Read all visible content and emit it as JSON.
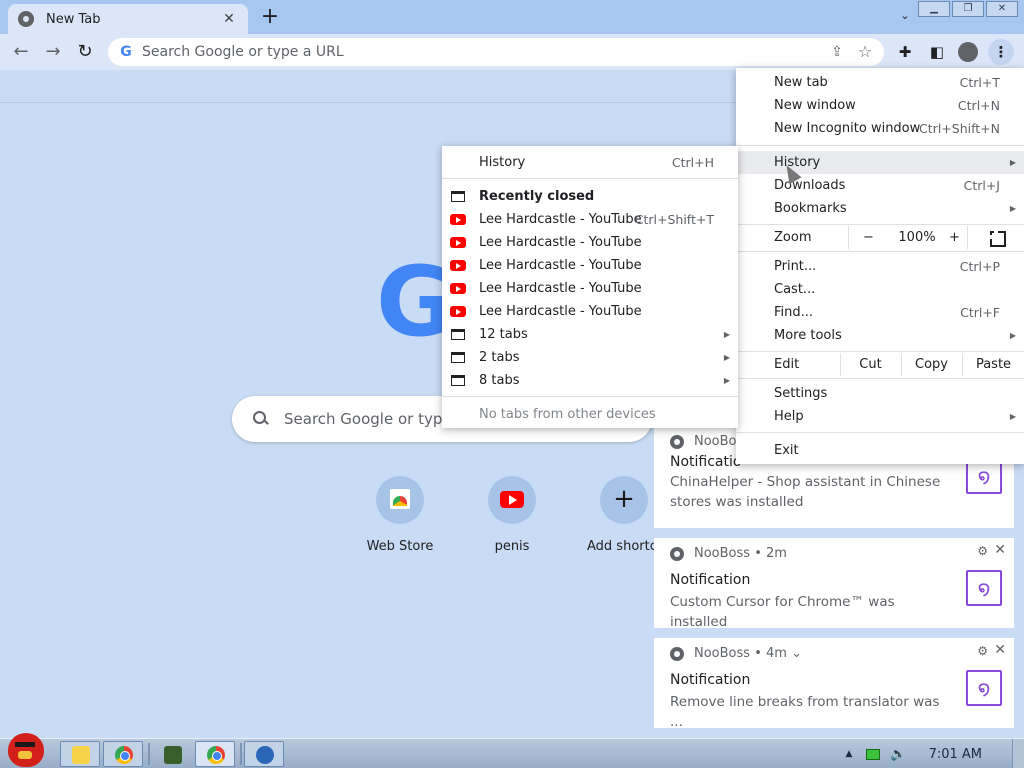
{
  "tab": {
    "title": "New Tab",
    "close": "✕"
  },
  "tabstrip": {
    "new_tab": "+",
    "tab_search": "⌄"
  },
  "window_controls": {
    "minimize": "▁",
    "restore": "❐",
    "close": "✕"
  },
  "toolbar": {
    "back": "←",
    "forward": "→",
    "reload": "↻",
    "omnibox_placeholder": "Search Google or type a URL",
    "share": "⇪",
    "bookmark": "☆",
    "extensions": "✚",
    "sidepanel": "◧",
    "menu": "⋮"
  },
  "ntp": {
    "logo_letter": "G",
    "search_placeholder": "Search Google or type",
    "shortcuts": [
      {
        "label": "Web Store"
      },
      {
        "label": "penis"
      },
      {
        "label": "Add shortcu"
      }
    ]
  },
  "notifications": [
    {
      "app": "NooBoss",
      "time": "",
      "title": "Notificatio",
      "body": "ChinaHelper - Shop assistant in Chinese stores was installed"
    },
    {
      "app": "NooBoss",
      "time": "• 2m",
      "title": "Notification",
      "body": "Custom Cursor for Chrome™ was installed"
    },
    {
      "app": "NooBoss",
      "time": "• 4m ⌄",
      "title": "Notification",
      "body": "Remove line breaks from translator was ..."
    }
  ],
  "main_menu": {
    "new_tab": {
      "label": "New tab",
      "shortcut": "Ctrl+T"
    },
    "new_window": {
      "label": "New window",
      "shortcut": "Ctrl+N"
    },
    "incognito": {
      "label": "New Incognito window",
      "shortcut": "Ctrl+Shift+N"
    },
    "history": {
      "label": "History"
    },
    "downloads": {
      "label": "Downloads",
      "shortcut": "Ctrl+J"
    },
    "bookmarks": {
      "label": "Bookmarks"
    },
    "zoom": {
      "label": "Zoom",
      "minus": "−",
      "value": "100%",
      "plus": "+"
    },
    "print": {
      "label": "Print...",
      "shortcut": "Ctrl+P"
    },
    "cast": {
      "label": "Cast..."
    },
    "find": {
      "label": "Find...",
      "shortcut": "Ctrl+F"
    },
    "more_tools": {
      "label": "More tools"
    },
    "edit": {
      "label": "Edit",
      "cut": "Cut",
      "copy": "Copy",
      "paste": "Paste"
    },
    "settings": {
      "label": "Settings"
    },
    "help": {
      "label": "Help"
    },
    "exit": {
      "label": "Exit"
    }
  },
  "history_menu": {
    "history": {
      "label": "History",
      "shortcut": "Ctrl+H"
    },
    "recently_closed": "Recently closed",
    "items": [
      {
        "label": "Lee Hardcastle - YouTube",
        "shortcut": "Ctrl+Shift+T"
      },
      {
        "label": "Lee Hardcastle - YouTube",
        "shortcut": ""
      },
      {
        "label": "Lee Hardcastle - YouTube",
        "shortcut": ""
      },
      {
        "label": "Lee Hardcastle - YouTube",
        "shortcut": ""
      },
      {
        "label": "Lee Hardcastle - YouTube",
        "shortcut": ""
      }
    ],
    "windows": [
      {
        "label": "12 tabs"
      },
      {
        "label": "2 tabs"
      },
      {
        "label": "8 tabs"
      }
    ],
    "other_devices": "No tabs from other devices"
  },
  "taskbar": {
    "clock": "7:01 AM"
  },
  "glyphs": {
    "arrow": "▶",
    "gear": "⚙",
    "close": "✕",
    "swirl": "໑",
    "tray_up": "▲",
    "volume": "🔈"
  }
}
